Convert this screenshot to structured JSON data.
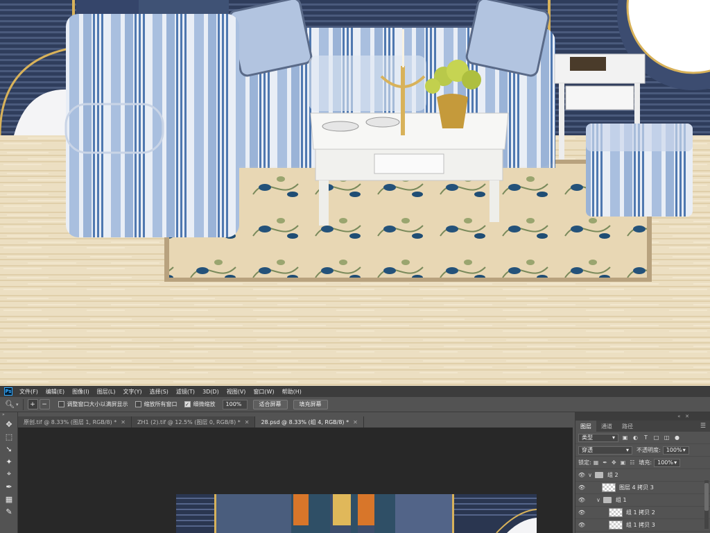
{
  "app": {
    "logo": "Ps"
  },
  "menu": [
    "文件(F)",
    "编辑(E)",
    "图像(I)",
    "图层(L)",
    "文字(Y)",
    "选择(S)",
    "滤镜(T)",
    "3D(D)",
    "视图(V)",
    "窗口(W)",
    "帮助(H)"
  ],
  "options": {
    "tool_icon": "zoom-tool-icon",
    "zoom_in": "+",
    "zoom_out": "−",
    "resize_windows_label": "调整窗口大小以满屏显示",
    "resize_windows_checked": false,
    "zoom_all_label": "缩放所有窗口",
    "zoom_all_checked": false,
    "scrubby_zoom_label": "细微缩放",
    "scrubby_zoom_checked": true,
    "zoom_value": "100%",
    "fit_screen": "适合屏幕",
    "fill_screen": "填充屏幕"
  },
  "tabs": [
    {
      "label": "原创.tif @ 8.33% (图层 1, RGB/8) *",
      "active": false
    },
    {
      "label": "ZH1 (2).tif @ 12.5% (图层 0, RGB/8) *",
      "active": false
    },
    {
      "label": "28.psd @ 8.33% (组 4, RGB/8) *",
      "active": true
    }
  ],
  "tools": [
    "move-tool-icon",
    "marquee-tool-icon",
    "lasso-tool-icon",
    "magic-wand-icon",
    "crop-tool-icon",
    "eyedropper-icon",
    "healing-brush-icon",
    "brush-tool-icon"
  ],
  "panel": {
    "tabs": [
      "图层",
      "通道",
      "路径"
    ],
    "filter_kind": "类型",
    "blend_mode": "穿透",
    "opacity_label": "不透明度:",
    "opacity_value": "100%",
    "lock_label": "锁定:",
    "fill_label": "填充:",
    "fill_value": "100%",
    "layers": [
      {
        "name": "组 2",
        "type": "group",
        "indent": 0,
        "expanded": true
      },
      {
        "name": "图层 4 拷贝 3",
        "type": "layer",
        "indent": 1
      },
      {
        "name": "组 1",
        "type": "group",
        "indent": 1,
        "expanded": true
      },
      {
        "name": "组 1 拷贝 2",
        "type": "layer",
        "indent": 2
      },
      {
        "name": "组 1 拷贝 3",
        "type": "layer",
        "indent": 2
      }
    ]
  },
  "colors": {
    "navy": "#3b4a69",
    "stripe_blue": "#7d9cc6",
    "floor": "#e9dcbf",
    "gold": "#d8b25a",
    "orange": "#d8762a",
    "teal": "#2f4f66"
  }
}
